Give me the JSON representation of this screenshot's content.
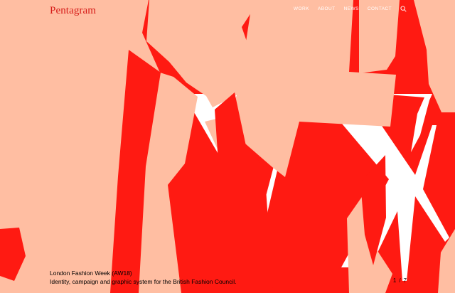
{
  "site": {
    "logo": "Pentagram"
  },
  "nav": {
    "items": [
      "WORK",
      "ABOUT",
      "NEWS",
      "CONTACT"
    ],
    "search_icon": "search-icon"
  },
  "project": {
    "title": "London Fashion Week (AW18)",
    "subtitle": "Identity, campaign and graphic system for the British Fashion Council."
  },
  "slideshow": {
    "current": "1",
    "separator": "/",
    "total": "7"
  },
  "colors": {
    "background": "#ff1a12",
    "accent_peach": "#ffbea2",
    "letter_white": "#ffffff",
    "logo_red": "#d61a17"
  }
}
